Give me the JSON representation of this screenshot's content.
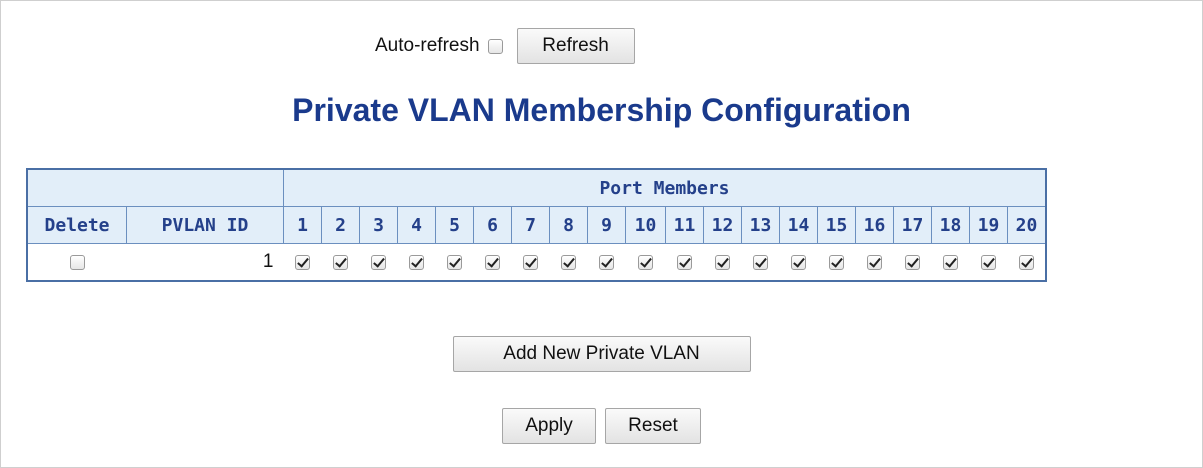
{
  "topbar": {
    "auto_refresh_label": "Auto-refresh",
    "refresh_label": "Refresh"
  },
  "title": "Private VLAN Membership Configuration",
  "table": {
    "group_header": "Port Members",
    "delete_header": "Delete",
    "pvlan_id_header": "PVLAN ID",
    "ports": [
      "1",
      "2",
      "3",
      "4",
      "5",
      "6",
      "7",
      "8",
      "9",
      "10",
      "11",
      "12",
      "13",
      "14",
      "15",
      "16",
      "17",
      "18",
      "19",
      "20"
    ],
    "rows": [
      {
        "delete_checked": false,
        "pvlan_id": "1",
        "members": [
          true,
          true,
          true,
          true,
          true,
          true,
          true,
          true,
          true,
          true,
          true,
          true,
          true,
          true,
          true,
          true,
          true,
          true,
          true,
          true
        ]
      }
    ]
  },
  "buttons": {
    "add_new": "Add New Private VLAN",
    "apply": "Apply",
    "reset": "Reset"
  },
  "colors": {
    "title": "#1a3a8c",
    "header_bg": "#e2eef9",
    "table_border": "#4a6fa5"
  }
}
